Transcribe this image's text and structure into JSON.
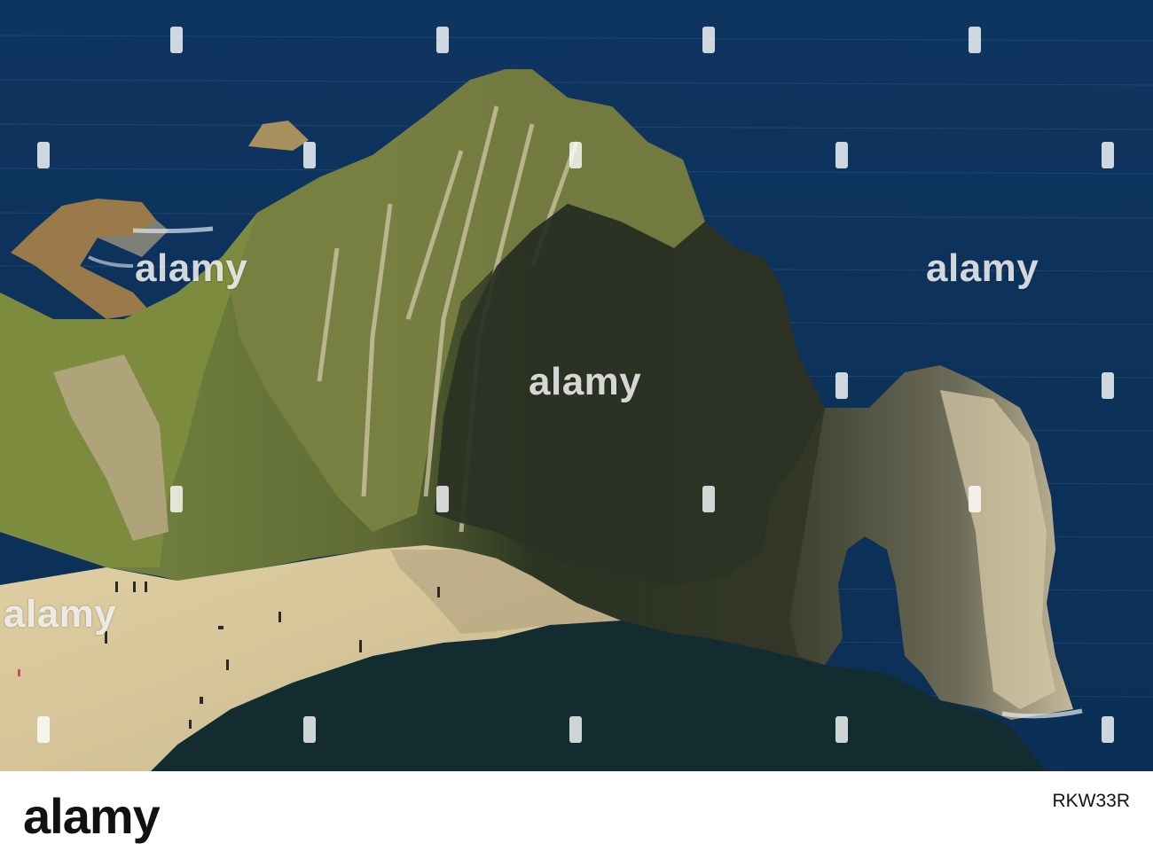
{
  "watermarks": {
    "text": "alamy",
    "count_visible": 5
  },
  "footer": {
    "logo_text": "alamy",
    "image_id": "RKW33R"
  },
  "colors": {
    "sea": "#0f3a66",
    "cliff_shadow": "#2d3a24",
    "grass": "#6a7a36",
    "chalk": "#c9c1a6",
    "sand": "#d8c9a0",
    "footer_bg": "#ffffff",
    "footer_text": "#111111"
  },
  "scene": {
    "subject": "coastal limestone arch and headland with beach"
  }
}
